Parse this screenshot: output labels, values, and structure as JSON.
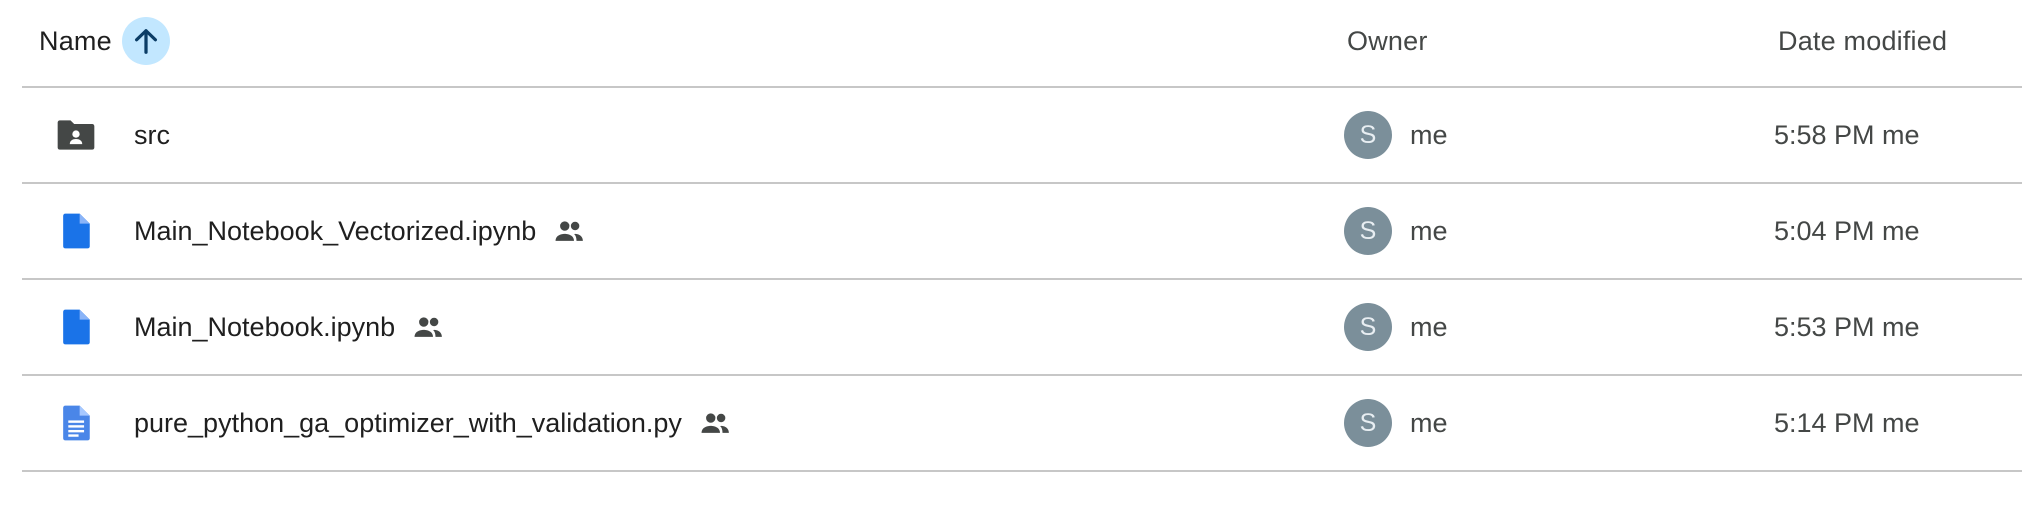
{
  "header": {
    "name_label": "Name",
    "owner_label": "Owner",
    "date_label": "Date modified",
    "sort_icon": "arrow-up-icon"
  },
  "colors": {
    "sort_button_bg": "#c2e7ff",
    "sort_arrow": "#0b3d66",
    "folder_icon": "#444746",
    "doc_icon": "#1a73e8",
    "avatar_bg": "#7b8f9a",
    "divider": "#c7c7c7"
  },
  "files": [
    {
      "name": "src",
      "type": "shared-folder",
      "icon": "shared-folder-icon",
      "shared": false,
      "owner_initial": "S",
      "owner": "me",
      "modified": "5:58 PM me"
    },
    {
      "name": "Main_Notebook_Vectorized.ipynb",
      "type": "file",
      "icon": "file-icon",
      "shared": true,
      "owner_initial": "S",
      "owner": "me",
      "modified": "5:04 PM me"
    },
    {
      "name": "Main_Notebook.ipynb",
      "type": "file",
      "icon": "file-icon",
      "shared": true,
      "owner_initial": "S",
      "owner": "me",
      "modified": "5:53 PM me"
    },
    {
      "name": "pure_python_ga_optimizer_with_validation.py",
      "type": "text-document",
      "icon": "text-document-icon",
      "shared": true,
      "owner_initial": "S",
      "owner": "me",
      "modified": "5:14 PM me"
    }
  ]
}
